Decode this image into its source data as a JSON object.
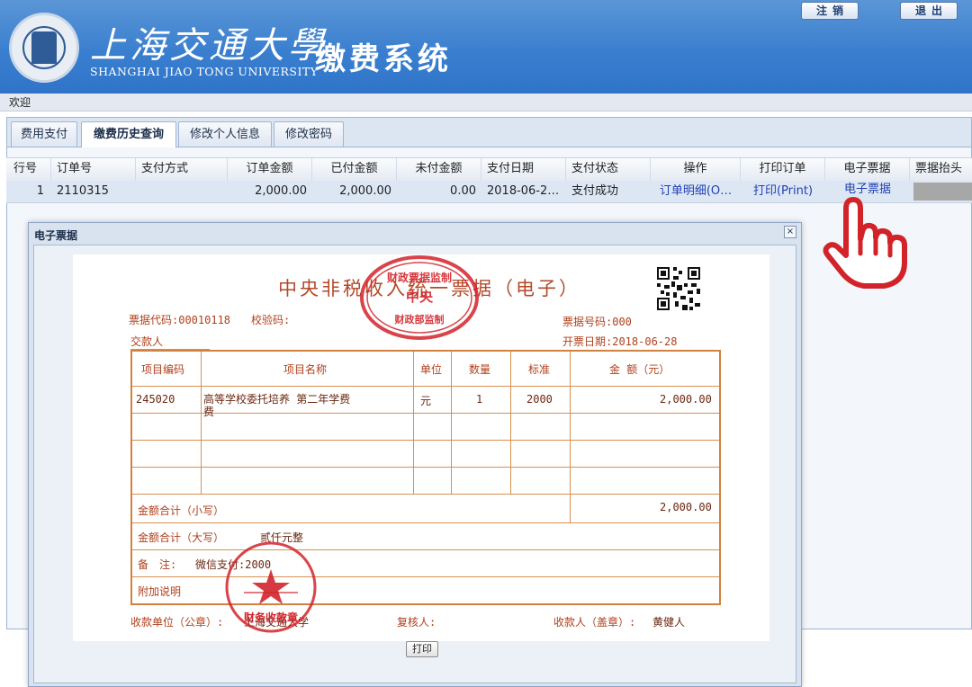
{
  "header": {
    "university_cn": "上海交通大學",
    "university_en": "SHANGHAI JIAO TONG UNIVERSITY",
    "system_title": "缴费系统",
    "logout_label": "注销",
    "exit_label": "退出"
  },
  "welcome": "欢迎",
  "tabs": [
    {
      "label": "费用支付",
      "active": false
    },
    {
      "label": "缴费历史查询",
      "active": true
    },
    {
      "label": "修改个人信息",
      "active": false
    },
    {
      "label": "修改密码",
      "active": false
    }
  ],
  "table": {
    "columns": [
      "行号",
      "订单号",
      "支付方式",
      "订单金额",
      "已付金额",
      "未付金额",
      "支付日期",
      "支付状态",
      "操作",
      "打印订单",
      "电子票据",
      "票据抬头"
    ],
    "rows": [
      {
        "row_no": "1",
        "order_no": "2110315",
        "pay_method": "",
        "order_amount": "2,000.00",
        "paid_amount": "2,000.00",
        "unpaid_amount": "0.00",
        "pay_date": "2018-06-2…",
        "pay_status": "支付成功",
        "action": "订单明细(O…",
        "print_order": "打印(Print)",
        "e_receipt": "电子票据"
      }
    ]
  },
  "dialog": {
    "title": "电子票据",
    "close_label": "×",
    "print_button": "打印"
  },
  "receipt": {
    "title": "中央非税收入统一票据（电子）",
    "code_label": "票据代码:00010118",
    "check_label": "校验码:",
    "number_label": "票据号码:000",
    "payer_label": "交款人",
    "date_label": "开票日期:2018-06-28",
    "headers": [
      "项目编码",
      "项目名称",
      "单位",
      "数量",
      "标准",
      "金 额（元）"
    ],
    "item": {
      "code": "245020",
      "name_line1": "高等学校委托培养 第二年学费",
      "name_line2": "费",
      "unit": "元",
      "qty": "1",
      "standard": "2000",
      "amount": "2,000.00"
    },
    "total_small_label": "金额合计（小写）",
    "total_small_value": "2,000.00",
    "total_big_label": "金额合计（大写）",
    "total_big_value": "贰仟元整",
    "remark_label": "备　注:",
    "remark_value": "微信支付:2000",
    "extra_label": "附加说明",
    "payee_unit_label": "收款单位（公章）:",
    "payee_unit_value": "上海交通大学",
    "reviewer_label": "复核人:",
    "collector_label": "收款人（盖章）:",
    "collector_value": "黄健人",
    "seal_top_lines": [
      "财政票据监制",
      "中央",
      "财政部监制"
    ],
    "seal_bottom_text": "财务收款章"
  },
  "colors": {
    "header_blue": "#3a7fcf",
    "receipt_red": "#b0401c",
    "seal_red": "#d2232a",
    "link_blue": "#1f3fb5",
    "table_border": "#d2813f"
  }
}
